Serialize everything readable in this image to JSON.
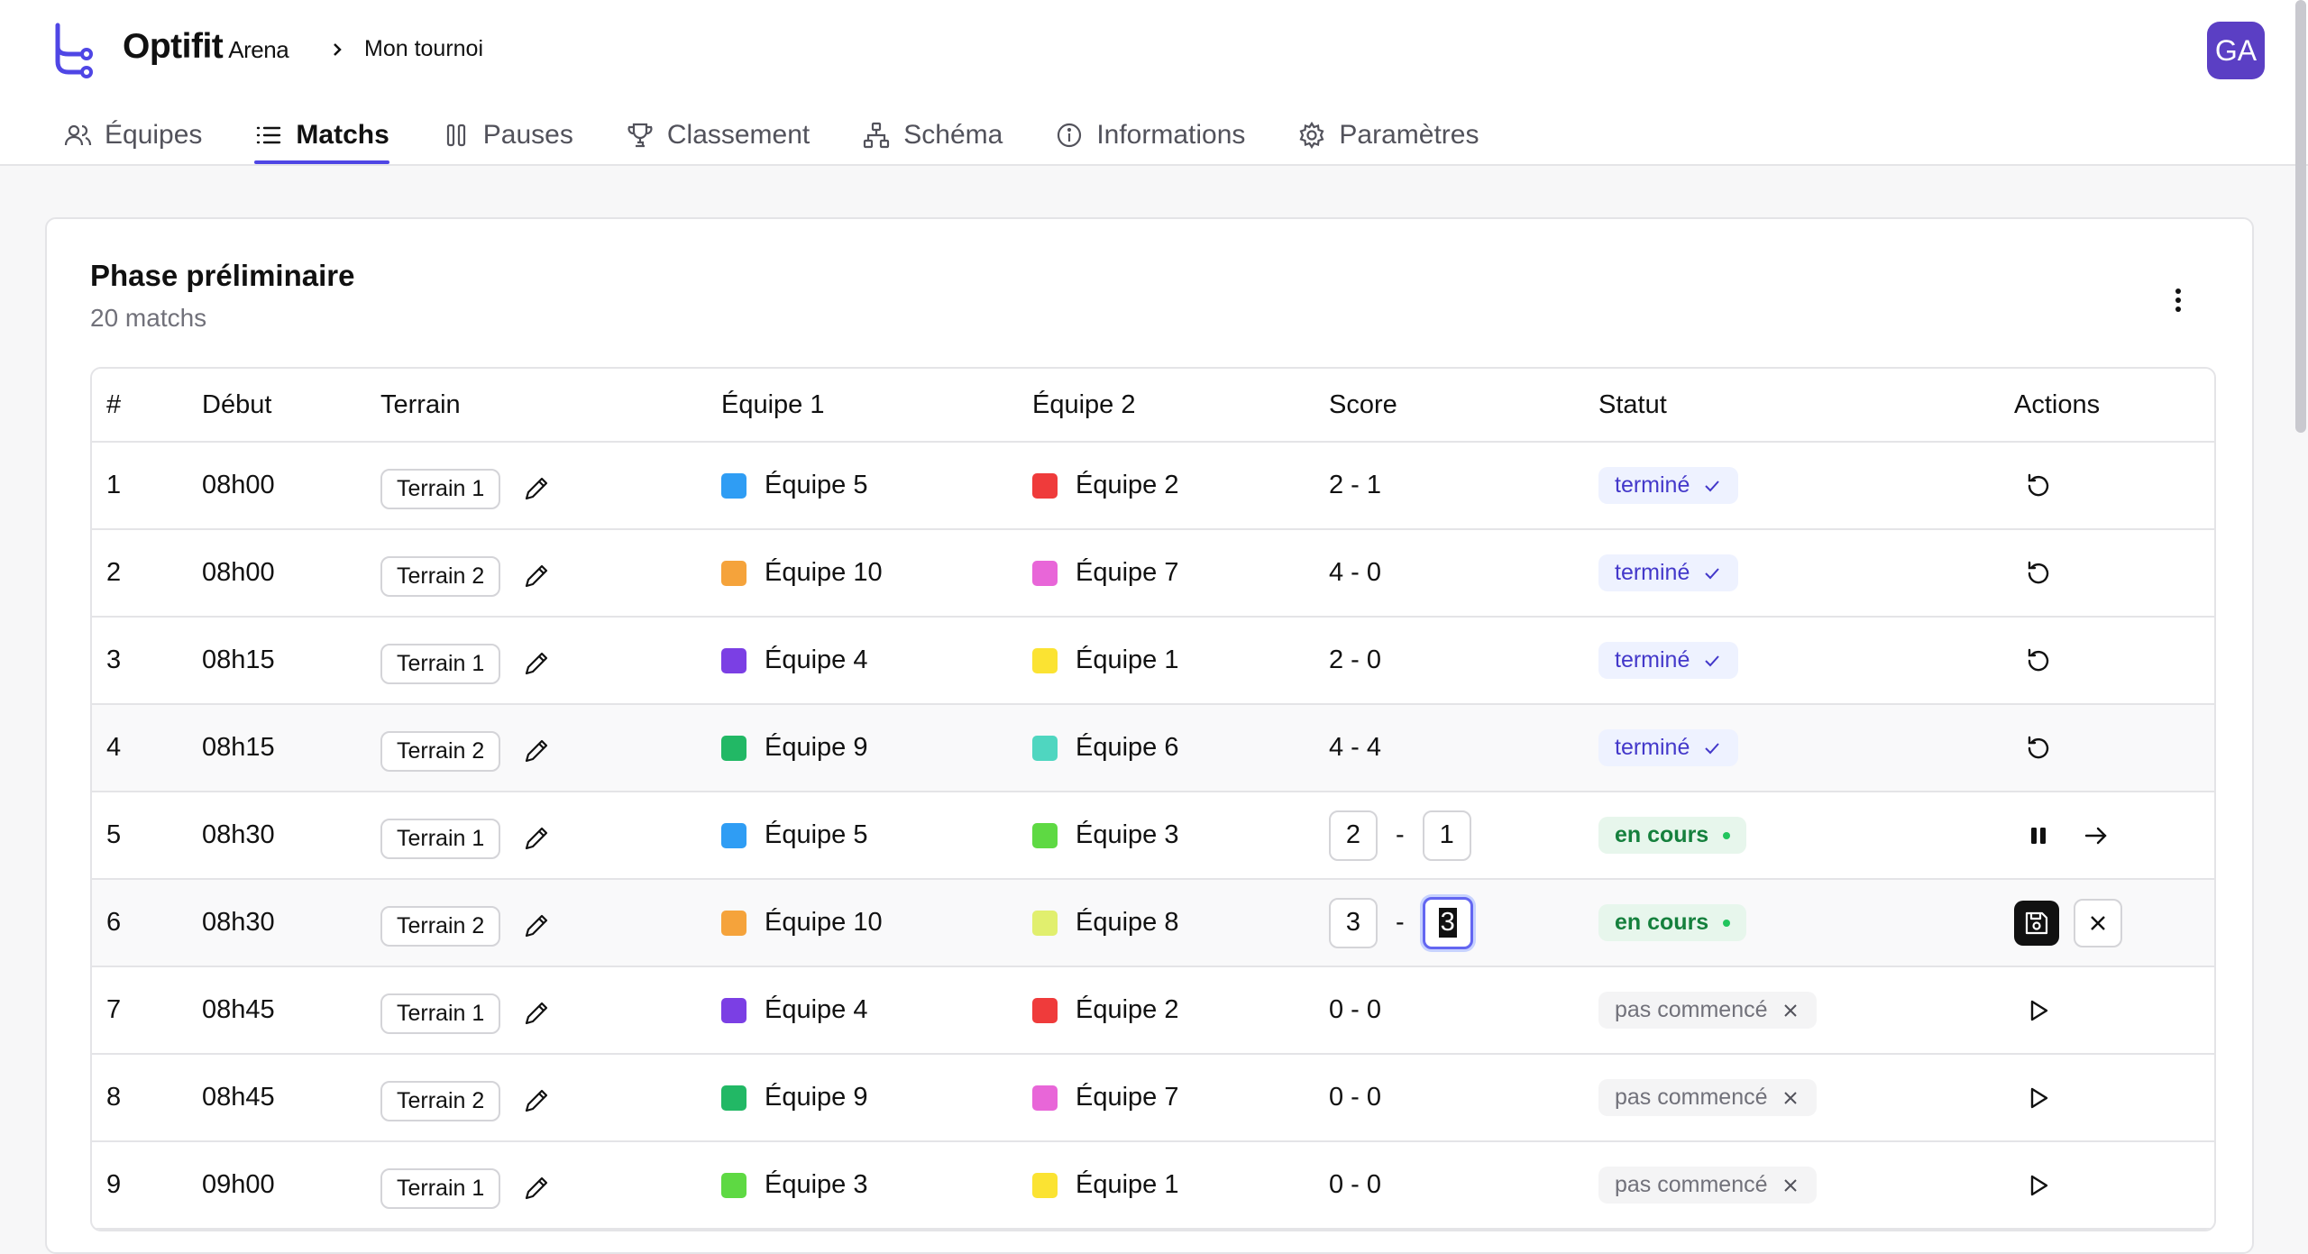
{
  "app": {
    "brand": "Optifit",
    "brand_sub": "Arena",
    "breadcrumb": "Mon tournoi",
    "avatar": "GA"
  },
  "tabs": [
    {
      "label": "Équipes",
      "icon": "users-icon"
    },
    {
      "label": "Matchs",
      "icon": "list-icon",
      "active": true
    },
    {
      "label": "Pauses",
      "icon": "pause-icon"
    },
    {
      "label": "Classement",
      "icon": "trophy-icon"
    },
    {
      "label": "Schéma",
      "icon": "sitemap-icon"
    },
    {
      "label": "Informations",
      "icon": "info-icon"
    },
    {
      "label": "Paramètres",
      "icon": "gear-icon"
    }
  ],
  "phase": {
    "title": "Phase préliminaire",
    "subtitle": "20 matchs"
  },
  "columns": {
    "num": "#",
    "debut": "Début",
    "terrain": "Terrain",
    "e1": "Équipe 1",
    "e2": "Équipe 2",
    "score": "Score",
    "statut": "Statut",
    "actions": "Actions"
  },
  "colors": {
    "blue": "#2f9df4",
    "orange": "#f5a33b",
    "purple": "#7b3fe4",
    "green": "#22b865",
    "red": "#ef3b3b",
    "pink": "#e866d8",
    "yellow": "#fbe332",
    "teal": "#4fd6c0",
    "lime": "#5ed943",
    "lightlime": "#e1ef6e"
  },
  "matches": [
    {
      "num": "1",
      "time": "08h00",
      "terrain": "Terrain 1",
      "e1": "Équipe 5",
      "e1_color": "#2f9df4",
      "e2": "Équipe 2",
      "e2_color": "#ef3b3b",
      "score": "2 - 1",
      "status": "terminé",
      "status_kind": "done"
    },
    {
      "num": "2",
      "time": "08h00",
      "terrain": "Terrain 2",
      "e1": "Équipe 10",
      "e1_color": "#f5a33b",
      "e2": "Équipe 7",
      "e2_color": "#e866d8",
      "score": "4 - 0",
      "status": "terminé",
      "status_kind": "done"
    },
    {
      "num": "3",
      "time": "08h15",
      "terrain": "Terrain 1",
      "e1": "Équipe 4",
      "e1_color": "#7b3fe4",
      "e2": "Équipe 1",
      "e2_color": "#fbe332",
      "score": "2 - 0",
      "status": "terminé",
      "status_kind": "done"
    },
    {
      "num": "4",
      "time": "08h15",
      "terrain": "Terrain 2",
      "e1": "Équipe 9",
      "e1_color": "#22b865",
      "e2": "Équipe 6",
      "e2_color": "#4fd6c0",
      "score": "4 - 4",
      "status": "terminé",
      "status_kind": "done"
    },
    {
      "num": "5",
      "time": "08h30",
      "terrain": "Terrain 1",
      "e1": "Équipe 5",
      "e1_color": "#2f9df4",
      "e2": "Équipe 3",
      "e2_color": "#5ed943",
      "score1": "2",
      "score2": "1",
      "status": "en cours",
      "status_kind": "live",
      "actions": "pause-next"
    },
    {
      "num": "6",
      "time": "08h30",
      "terrain": "Terrain 2",
      "e1": "Équipe 10",
      "e1_color": "#f5a33b",
      "e2": "Équipe 8",
      "e2_color": "#e1ef6e",
      "score1": "3",
      "score2": "3",
      "status": "en cours",
      "status_kind": "live",
      "actions": "save-cancel"
    },
    {
      "num": "7",
      "time": "08h45",
      "terrain": "Terrain 1",
      "e1": "Équipe 4",
      "e1_color": "#7b3fe4",
      "e2": "Équipe 2",
      "e2_color": "#ef3b3b",
      "score": "0 - 0",
      "status": "pas commencé",
      "status_kind": "todo"
    },
    {
      "num": "8",
      "time": "08h45",
      "terrain": "Terrain 2",
      "e1": "Équipe 9",
      "e1_color": "#22b865",
      "e2": "Équipe 7",
      "e2_color": "#e866d8",
      "score": "0 - 0",
      "status": "pas commencé",
      "status_kind": "todo"
    },
    {
      "num": "9",
      "time": "09h00",
      "terrain": "Terrain 1",
      "e1": "Équipe 3",
      "e1_color": "#5ed943",
      "e2": "Équipe 1",
      "e2_color": "#fbe332",
      "score": "0 - 0",
      "status": "pas commencé",
      "status_kind": "todo"
    }
  ]
}
